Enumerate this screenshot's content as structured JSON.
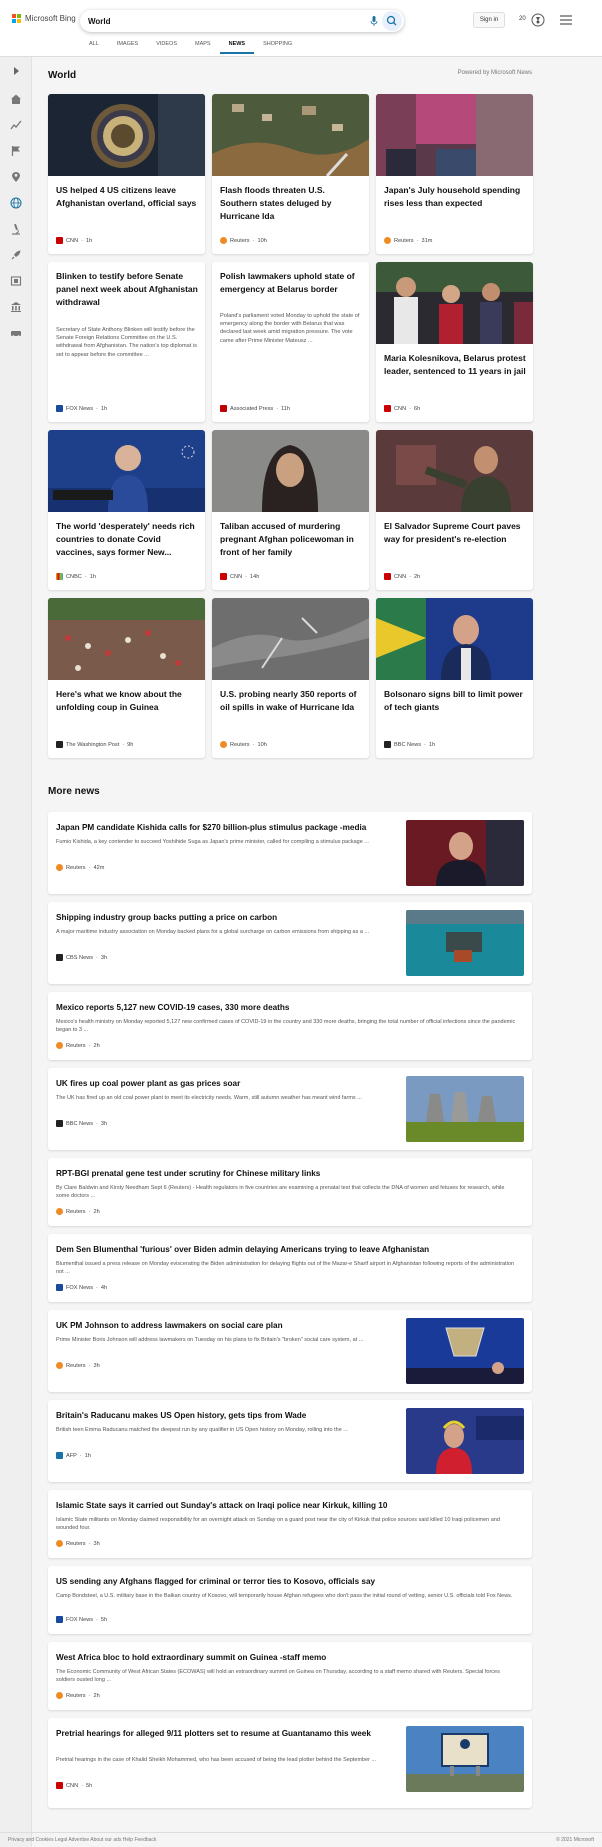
{
  "header": {
    "logo_text": "Microsoft Bing",
    "search_value": "World",
    "sign_in": "Sign in",
    "rewards_count": "20",
    "nav": [
      "ALL",
      "IMAGES",
      "VIDEOS",
      "MAPS",
      "NEWS",
      "SHOPPING"
    ],
    "active_nav": "NEWS"
  },
  "colors": {
    "accent": "#1a73a8",
    "cnn": "#cc0000",
    "reuters": "#f08a24",
    "fox": "#1a4a9e"
  },
  "world": {
    "title": "World",
    "powered_by": "Powered by Microsoft News",
    "cards": [
      {
        "title": "US helped 4 US citizens leave Afghanistan overland, official says",
        "snippet": "",
        "source": "CNN",
        "time": "1h"
      },
      {
        "title": "Flash floods threaten U.S. Southern states deluged by Hurricane Ida",
        "snippet": "",
        "source": "Reuters",
        "time": "10h"
      },
      {
        "title": "Japan's July household spending rises less than expected",
        "snippet": "",
        "source": "Reuters",
        "time": "31m"
      },
      {
        "title": "Blinken to testify before Senate panel next week about Afghanistan withdrawal",
        "snippet": "Secretary of State Anthony Blinken will testify before the Senate Foreign Relations Committee on the U.S. withdrawal from Afghanistan. The nation's top diplomat is set to appear before the committee ...",
        "source": "FOX News",
        "time": "1h"
      },
      {
        "title": "Polish lawmakers uphold state of emergency at Belarus border",
        "snippet": "Poland's parliament voted Monday to uphold the state of emergency along the border with Belarus that was declared last week amid migration pressure. The vote came after Prime Minister Mateusz ...",
        "source": "Associated Press",
        "time": "11h"
      },
      {
        "title": "Maria Kolesnikova, Belarus protest leader, sentenced to 11 years in jail",
        "snippet": "",
        "source": "CNN",
        "time": "6h"
      },
      {
        "title": "The world 'desperately' needs rich countries to donate Covid vaccines, says former New...",
        "snippet": "",
        "source": "CNBC",
        "time": "1h"
      },
      {
        "title": "Taliban accused of murdering pregnant Afghan policewoman in front of her family",
        "snippet": "",
        "source": "CNN",
        "time": "14h"
      },
      {
        "title": "El Salvador Supreme Court paves way for president's re-election",
        "snippet": "",
        "source": "CNN",
        "time": "2h"
      },
      {
        "title": "Here's what we know about the unfolding coup in Guinea",
        "snippet": "",
        "source": "The Washington Post",
        "time": "9h"
      },
      {
        "title": "U.S. probing nearly 350 reports of oil spills in wake of Hurricane Ida",
        "snippet": "",
        "source": "Reuters",
        "time": "10h"
      },
      {
        "title": "Bolsonaro signs bill to limit power of tech giants",
        "snippet": "",
        "source": "BBC News",
        "time": "1h"
      }
    ]
  },
  "more": {
    "title": "More news",
    "items": [
      {
        "title": "Japan PM candidate Kishida calls for $270 billion-plus stimulus package -media",
        "snippet": "Fumio Kishida, a key contender to succeed Yoshihide Suga as Japan's prime minister, called for compiling a stimulus package ...",
        "source": "Reuters",
        "time": "42m"
      },
      {
        "title": "Shipping industry group backs putting a price on carbon",
        "snippet": "A major maritime industry association on Monday backed plans for a global surcharge on carbon emissions from shipping as a ...",
        "source": "CBS News",
        "time": "3h"
      },
      {
        "title": "Mexico reports 5,127 new COVID-19 cases, 330 more deaths",
        "snippet": "Mexico's health ministry on Monday reported 5,127 new confirmed cases of COVID-19 in the country and 330 more deaths, bringing the total number of official infections since the pandemic began to 3 ...",
        "source": "Reuters",
        "time": "2h"
      },
      {
        "title": "UK fires up coal power plant as gas prices soar",
        "snippet": "The UK has fired up an old coal power plant to meet its electricity needs. Warm, still autumn weather has meant wind farms ...",
        "source": "BBC News",
        "time": "3h"
      },
      {
        "title": "RPT-BGI prenatal gene test under scrutiny for Chinese military links",
        "snippet": "By Clare Baldwin and Kirsty Needham Sept 6 (Reuters) - Health regulators in five countries are examining a prenatal test that collects the DNA of women and fetuses for research, while some doctors ...",
        "source": "Reuters",
        "time": "2h"
      },
      {
        "title": "Dem Sen Blumenthal 'furious' over Biden admin delaying Americans trying to leave Afghanistan",
        "snippet": "Blumenthal issued a press release on Monday eviscerating the Biden administration for delaying flights out of the Mazar-e Sharif airport in Afghanistan following reports of the administration not ...",
        "source": "FOX News",
        "time": "4h"
      },
      {
        "title": "UK PM Johnson to address lawmakers on social care plan",
        "snippet": "Prime Minister Boris Johnson will address lawmakers on Tuesday on his plans to fix Britain's \"broken\" social care system, at ...",
        "source": "Reuters",
        "time": "3h"
      },
      {
        "title": "Britain's Raducanu makes US Open history, gets tips from Wade",
        "snippet": "British teen Emma Raducanu matched the deepest run by any qualifier in US Open history on Monday, rolling into the ...",
        "source": "AFP",
        "time": "1h"
      },
      {
        "title": "Islamic State says it carried out Sunday's attack on Iraqi police near Kirkuk, killing 10",
        "snippet": "Islamic State militants on Monday claimed responsibility for an overnight attack on Sunday on a guard post near the city of Kirkuk that police sources said killed 10 Iraqi policemen and wounded four.",
        "source": "Reuters",
        "time": "3h"
      },
      {
        "title": "US sending any Afghans flagged for criminal or terror ties to Kosovo, officials say",
        "snippet": "Camp Bondsteel, a U.S. military base in the Balkan country of Kosovo, will temporarily house Afghan refugees who don't pass the initial round of vetting, senior U.S. officials told Fox News.",
        "source": "FOX News",
        "time": "5h"
      },
      {
        "title": "West Africa bloc to hold extraordinary summit on Guinea -staff memo",
        "snippet": "The Economic Community of West African States (ECOWAS) will hold an extraordinary summit on Guinea on Thursday, according to a staff memo shared with Reuters. Special forces soldiers ousted long ...",
        "source": "Reuters",
        "time": "2h"
      },
      {
        "title": "Pretrial hearings for alleged 9/11 plotters set to resume at Guantanamo this week",
        "snippet": "Pretrial hearings in the case of Khalid Sheikh Mohammed, who has been accused of being the lead plotter behind the September ...",
        "source": "CNN",
        "time": "5h"
      }
    ]
  },
  "footer": {
    "left": "Privacy and Cookies   Legal   Advertise   About our ads   Help   Feedback",
    "right": "© 2021 Microsoft"
  }
}
